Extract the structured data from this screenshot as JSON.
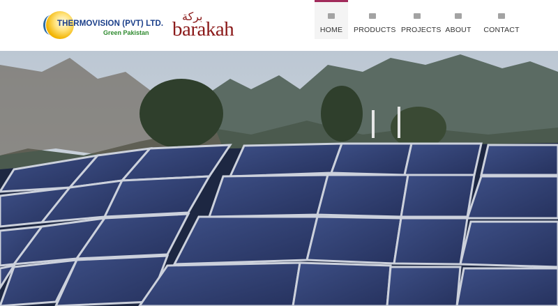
{
  "brand": {
    "title": "THERMOVISION (PVT) LTD.",
    "subtitle": "Green Pakistan",
    "partner": "barakah",
    "partner_arabic": "بركة"
  },
  "nav": {
    "items": [
      {
        "label": "HOME",
        "icon": "home-icon",
        "active": true
      },
      {
        "label": "PRODUCTS",
        "icon": "camera-icon",
        "active": false
      },
      {
        "label": "PROJECTS",
        "icon": "camera-icon",
        "active": false
      },
      {
        "label": "ABOUT",
        "icon": "user-icon",
        "active": false
      },
      {
        "label": "CONTACT",
        "icon": "envelope-icon",
        "active": false
      }
    ]
  },
  "colors": {
    "accent": "#a12b5b",
    "brand_blue": "#1b3f8a",
    "brand_green": "#2f8a2f",
    "partner_red": "#8b1a1a"
  }
}
